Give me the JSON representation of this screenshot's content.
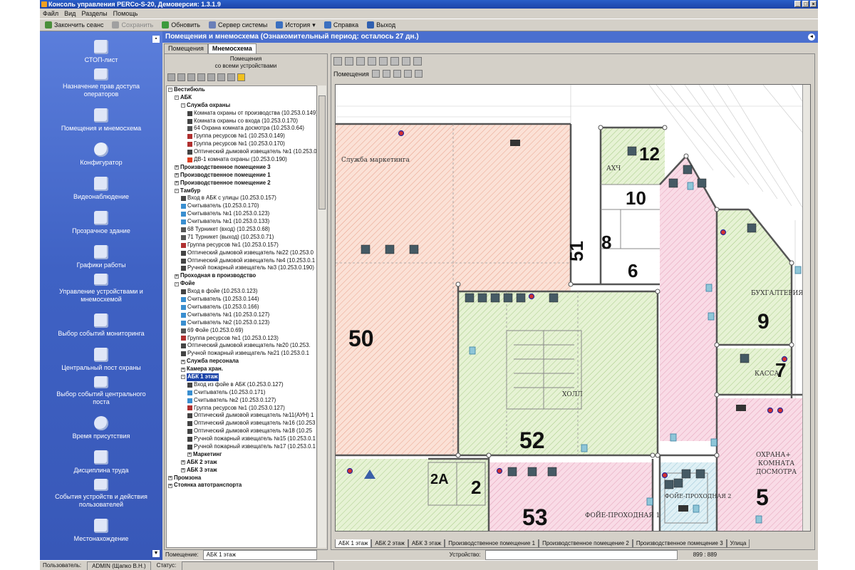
{
  "window": {
    "title": "Консоль управления PERCo-S-20, Демоверсия: 1.3.1.9"
  },
  "menu": [
    "Файл",
    "Вид",
    "Разделы",
    "Помощь"
  ],
  "toolbar": [
    {
      "label": "Закончить сеанс",
      "icon": "end-session-icon",
      "color": "#4a8f3a",
      "enabled": true
    },
    {
      "label": "Сохранить",
      "icon": "save-icon",
      "color": "#a0a0a0",
      "enabled": false
    },
    {
      "label": "Обновить",
      "icon": "refresh-icon",
      "color": "#3c9a3c",
      "enabled": true
    },
    {
      "label": "Сервер системы",
      "icon": "server-icon",
      "color": "#6a7fb8",
      "enabled": true
    },
    {
      "label": "История",
      "icon": "history-icon",
      "color": "#3a6fc0",
      "enabled": true
    },
    {
      "label": "Справка",
      "icon": "help-icon",
      "color": "#3a6fc0",
      "enabled": true
    },
    {
      "label": "Выход",
      "icon": "exit-icon",
      "color": "#2f5fb0",
      "enabled": true
    }
  ],
  "sidebar": [
    {
      "label": "СТОП-лист",
      "icon": "stop-list-icon"
    },
    {
      "label": "Назначение прав доступа операторов",
      "icon": "access-rights-icon"
    },
    {
      "label": "Помещения и мнемосхема",
      "icon": "rooms-icon"
    },
    {
      "label": "Конфигуратор",
      "icon": "gear-icon"
    },
    {
      "label": "Видеонаблюдение",
      "icon": "video-icon"
    },
    {
      "label": "Прозрачное здание",
      "icon": "building-icon"
    },
    {
      "label": "Графики работы",
      "icon": "chart-icon"
    },
    {
      "label": "Управление устройствами и мнемосхемой",
      "icon": "device-control-icon"
    },
    {
      "label": "Выбор событий мониторинга",
      "icon": "calendar-icon"
    },
    {
      "label": "Центральный пост охраны",
      "icon": "guard-icon"
    },
    {
      "label": "Выбор событий центрального поста",
      "icon": "calendar-icon"
    },
    {
      "label": "Время присутствия",
      "icon": "clock-icon"
    },
    {
      "label": "Дисциплина труда",
      "icon": "gavel-icon"
    },
    {
      "label": "События устройств и действия пользователей",
      "icon": "events-icon"
    },
    {
      "label": "Местонахождение",
      "icon": "location-icon"
    }
  ],
  "panel": {
    "title": "Помещения и мнемосхема (Ознакомительный период: осталось 27 дн.)",
    "tabs": [
      "Помещения",
      "Мнемосхема"
    ],
    "tree_header": [
      "Помещения",
      "со всеми устройствами"
    ]
  },
  "tree": [
    {
      "d": 0,
      "t": "Вестибюль",
      "b": true,
      "e": "-"
    },
    {
      "d": 1,
      "t": "АБК",
      "b": true,
      "e": "-"
    },
    {
      "d": 2,
      "t": "Служба охраны",
      "b": true,
      "e": "-"
    },
    {
      "d": 3,
      "t": "Комната охраны от производства (10.253.0.149)",
      "i": "#444"
    },
    {
      "d": 3,
      "t": "Комната охраны со входа (10.253.0.170)",
      "i": "#444"
    },
    {
      "d": 3,
      "t": "64 Охрана комната досмотра (10.253.0.64)",
      "i": "#555"
    },
    {
      "d": 3,
      "t": "Группа ресурсов №1 (10.253.0.149)",
      "i": "#b03030"
    },
    {
      "d": 3,
      "t": "Группа ресурсов №1 (10.253.0.170)",
      "i": "#b03030"
    },
    {
      "d": 3,
      "t": "Оптический дымовой извещатель №1 (10.253.0.",
      "i": "#444"
    },
    {
      "d": 3,
      "t": "ДВ-1 комната охраны (10.253.0.190)",
      "i": "#e04020"
    },
    {
      "d": 1,
      "t": "Производственное помещение 3",
      "b": true,
      "e": "+"
    },
    {
      "d": 1,
      "t": "Производственное помещение 1",
      "b": true,
      "e": "+"
    },
    {
      "d": 1,
      "t": "Производственное помещение 2",
      "b": true,
      "e": "+"
    },
    {
      "d": 1,
      "t": "Тамбур",
      "b": true,
      "e": "-"
    },
    {
      "d": 2,
      "t": "Вход в АБК с улицы (10.253.0.157)",
      "i": "#444"
    },
    {
      "d": 2,
      "t": "Считыватель (10.253.0.170)",
      "i": "#3a8fd0"
    },
    {
      "d": 2,
      "t": "Считыватель №1 (10.253.0.123)",
      "i": "#3a8fd0"
    },
    {
      "d": 2,
      "t": "Считыватель №1 (10.253.0.133)",
      "i": "#3a8fd0"
    },
    {
      "d": 2,
      "t": "68 Турникет (вход) (10.253.0.68)",
      "i": "#555"
    },
    {
      "d": 2,
      "t": "71 Турникет (выход) (10.253.0.71)",
      "i": "#555"
    },
    {
      "d": 2,
      "t": "Группа ресурсов №1 (10.253.0.157)",
      "i": "#b03030"
    },
    {
      "d": 2,
      "t": "Оптический дымовой извещатель №22 (10.253.0",
      "i": "#444"
    },
    {
      "d": 2,
      "t": "Оптический дымовой извещатель №4 (10.253.0.1",
      "i": "#444"
    },
    {
      "d": 2,
      "t": "Ручной пожарный извещатель №3 (10.253.0.190)",
      "i": "#444"
    },
    {
      "d": 1,
      "t": "Проходная в производство",
      "b": true,
      "e": "+"
    },
    {
      "d": 1,
      "t": "Фойе",
      "b": true,
      "e": "-"
    },
    {
      "d": 2,
      "t": "Вход в фойе (10.253.0.123)",
      "i": "#444"
    },
    {
      "d": 2,
      "t": "Считыватель (10.253.0.144)",
      "i": "#3a8fd0"
    },
    {
      "d": 2,
      "t": "Считыватель (10.253.0.166)",
      "i": "#3a8fd0"
    },
    {
      "d": 2,
      "t": "Считыватель №1 (10.253.0.127)",
      "i": "#3a8fd0"
    },
    {
      "d": 2,
      "t": "Считыватель №2 (10.253.0.123)",
      "i": "#3a8fd0"
    },
    {
      "d": 2,
      "t": "69 Фойе (10.253.0.69)",
      "i": "#555"
    },
    {
      "d": 2,
      "t": "Группа ресурсов №1 (10.253.0.123)",
      "i": "#b03030"
    },
    {
      "d": 2,
      "t": "Оптический дымовой извещатель №20 (10.253.",
      "i": "#444"
    },
    {
      "d": 2,
      "t": "Ручной пожарный извещатель №21 (10.253.0.1",
      "i": "#444"
    },
    {
      "d": 2,
      "t": "Служба персонала",
      "b": true,
      "e": "+"
    },
    {
      "d": 2,
      "t": "Камера хран.",
      "b": true,
      "e": "+"
    },
    {
      "d": 2,
      "t": "АБК 1 этаж",
      "b": true,
      "e": "-",
      "sel": true
    },
    {
      "d": 3,
      "t": "Вход из фойе в АБК (10.253.0.127)",
      "i": "#444"
    },
    {
      "d": 3,
      "t": "Считыватель (10.253.0.171)",
      "i": "#3a8fd0"
    },
    {
      "d": 3,
      "t": "Считыватель №2 (10.253.0.127)",
      "i": "#3a8fd0"
    },
    {
      "d": 3,
      "t": "Группа ресурсов №1 (10.253.0.127)",
      "i": "#b03030"
    },
    {
      "d": 3,
      "t": "Оптический дымовой извещатель №11(АУН) 1",
      "i": "#444"
    },
    {
      "d": 3,
      "t": "Оптический дымовой извещатель №16 (10.253",
      "i": "#444"
    },
    {
      "d": 3,
      "t": "Оптический дымовой извещатель №18 (10.25",
      "i": "#444"
    },
    {
      "d": 3,
      "t": "Ручной пожарный извещатель №15 (10.253.0.1",
      "i": "#444"
    },
    {
      "d": 3,
      "t": "Ручной пожарный извещатель №17 (10.253.0.1",
      "i": "#444"
    },
    {
      "d": 3,
      "t": "Маркетинг",
      "b": true,
      "e": "+"
    },
    {
      "d": 2,
      "t": "АБК 2 этаж",
      "b": true,
      "e": "+"
    },
    {
      "d": 2,
      "t": "АБК 3 этаж",
      "b": true,
      "e": "+"
    },
    {
      "d": 0,
      "t": "Промзона",
      "b": true,
      "e": "+"
    },
    {
      "d": 0,
      "t": "Стоянка автотранспорта",
      "b": true,
      "e": "+"
    }
  ],
  "map": {
    "label": "Помещения",
    "rooms": {
      "r50": "50",
      "r51": "51",
      "r52": "52",
      "r53": "53",
      "r5": "5",
      "r6": "6",
      "r7": "7",
      "r8": "8",
      "r9": "9",
      "r10": "10",
      "r12": "12",
      "r2": "2",
      "r2a": "2А"
    },
    "labels": {
      "marketing": "Служба маркетинга",
      "akh": "АХЧ",
      "buh": "БУХГАЛТЕРИЯ",
      "kassa": "КАССА",
      "holl": "ХОЛЛ",
      "okhrana1": "ОХРАНА+",
      "okhrana2": "КОМНАТА",
      "okhrana3": "ДОСМОТРА",
      "foyer": "ФОЙЕ-ПРОХОДНАЯ 1",
      "foyer2": "ФОЙЕ-ПРОХОДНАЯ 2"
    },
    "tabs": [
      "АБК 1 этаж",
      "АБК 2 этаж",
      "АБК 3 этаж",
      "Производственное помещение 1",
      "Производственное помещение 2",
      "Производственное помещение 3",
      "Улица"
    ]
  },
  "status": {
    "rooms_label": "Помещение:",
    "rooms_value": "АБК 1 этаж",
    "device_label": "Устройство:",
    "coords": "899 : 889",
    "user_label": "Пользователь:",
    "user_value": "ADMIN (Щапко В.Н.)",
    "state_label": "Статус:"
  }
}
